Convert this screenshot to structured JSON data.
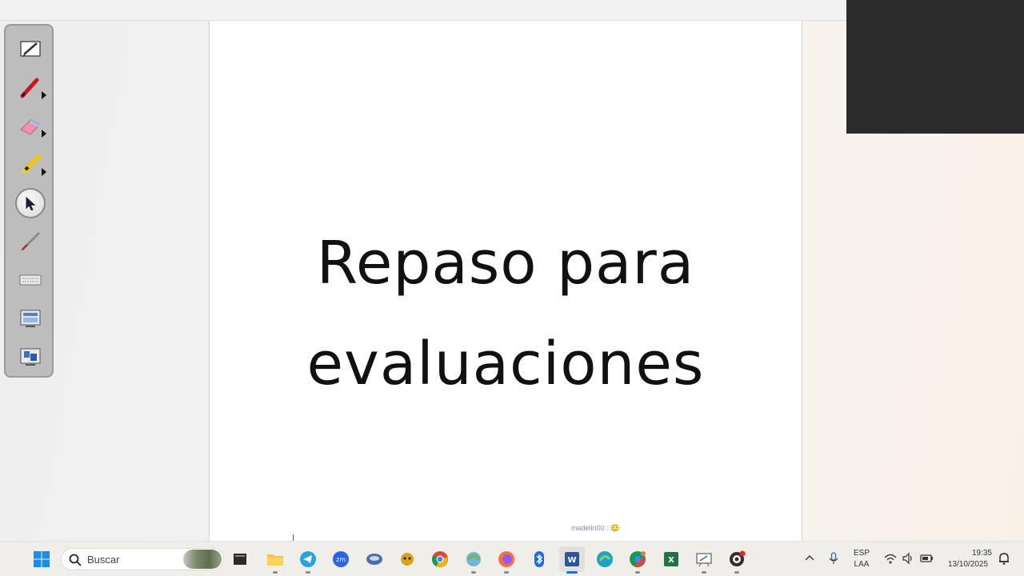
{
  "slide": {
    "title_line1": "Repaso para",
    "title_line2": "evaluaciones"
  },
  "chat": {
    "note": "madelin00 : 😳"
  },
  "toolbar": {
    "tools": [
      {
        "name": "notebook-icon",
        "has_menu": false
      },
      {
        "name": "pen-icon",
        "has_menu": true
      },
      {
        "name": "eraser-icon",
        "has_menu": true
      },
      {
        "name": "highlighter-icon",
        "has_menu": true
      },
      {
        "name": "select-pointer-icon",
        "selected": true
      },
      {
        "name": "magic-pen-icon"
      },
      {
        "name": "keyboard-icon"
      },
      {
        "name": "screen-capture-icon"
      },
      {
        "name": "display-icon"
      }
    ]
  },
  "taskbar": {
    "search_placeholder": "Buscar",
    "apps": [
      "start-icon",
      "file-explorer-icon",
      "folder-icon",
      "telegram-icon",
      "zoom-icon",
      "vpn-icon",
      "bot-icon",
      "chrome-icon",
      "maps-icon",
      "firefox-icon",
      "bluetooth-icon",
      "word-icon",
      "edge-icon",
      "chrome-profile-icon",
      "excel-icon",
      "whiteboard-icon",
      "obs-icon"
    ],
    "language": "ESP",
    "keyboard_layout": "LAA",
    "time": "19:35",
    "date": "13/10/2025"
  },
  "colors": {
    "taskbar_bg": "#efeee9",
    "toolbar_bg": "#bdbdbd",
    "video_panel": "#2c2c2c",
    "accent": "#2a6dc9"
  }
}
